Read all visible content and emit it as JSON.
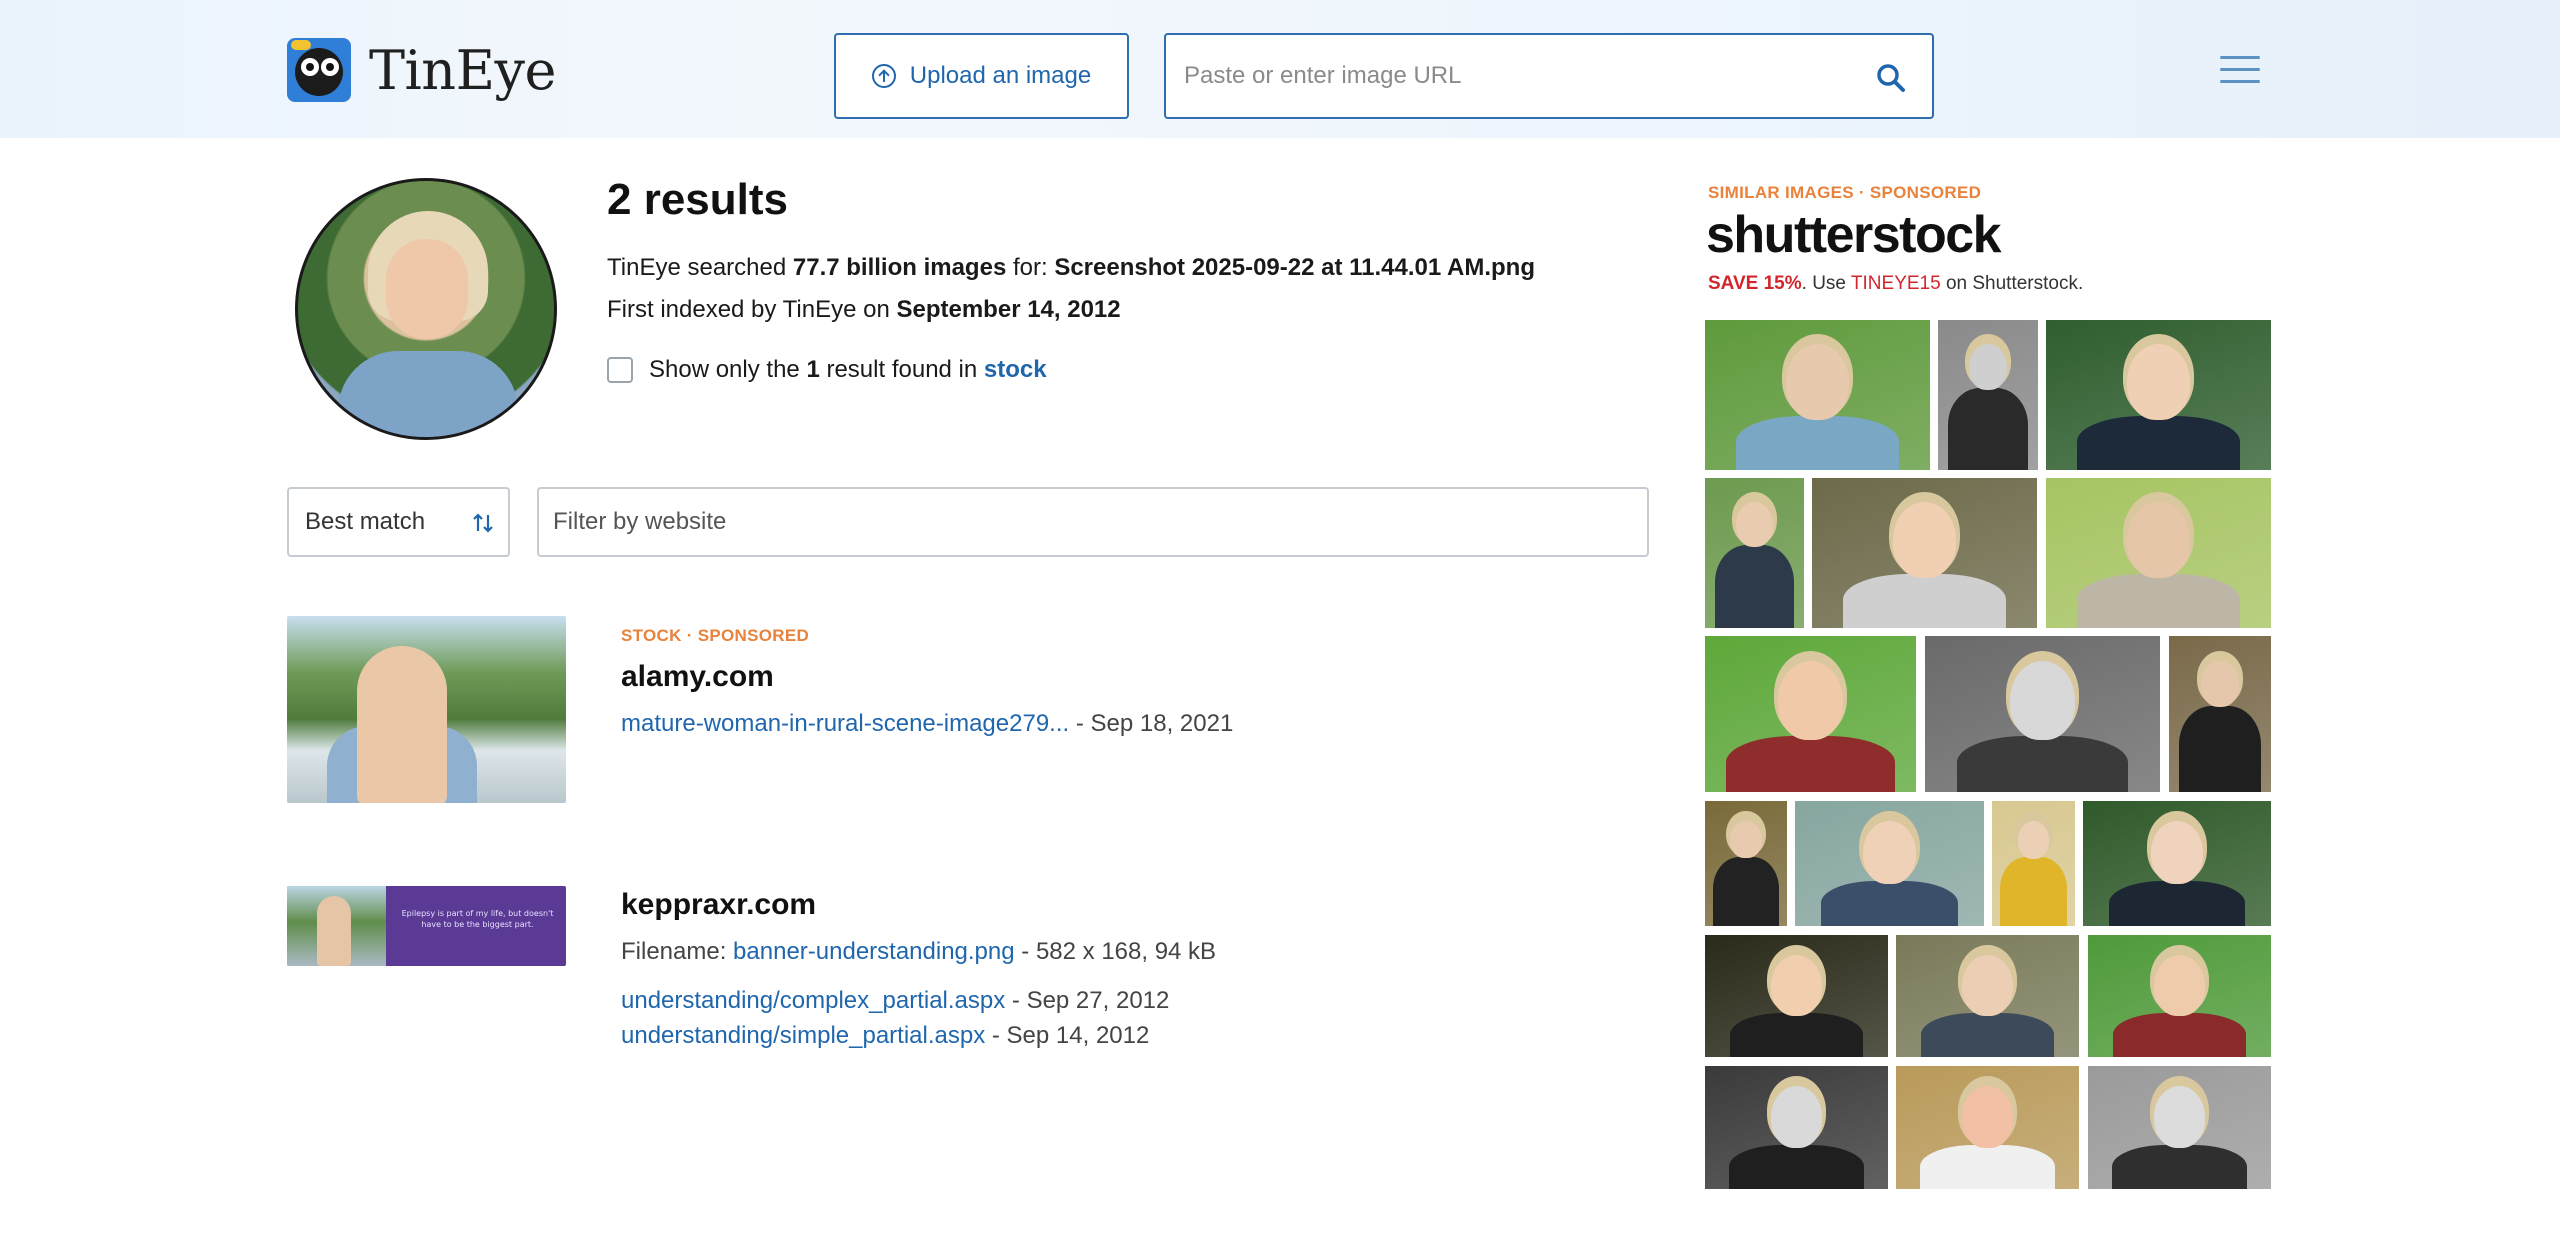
{
  "header": {
    "logo_text": "TinEye",
    "upload_label": "Upload an image",
    "url_placeholder": "Paste or enter image URL"
  },
  "summary": {
    "results_title": "2 results",
    "searched_prefix": "TinEye searched ",
    "searched_count": "77.7 billion images",
    "searched_for": " for: ",
    "filename": "Screenshot 2025-09-22 at 11.44.01 AM.png",
    "indexed_prefix": "First indexed by TinEye on ",
    "indexed_date": "September 14, 2012",
    "stock_prefix": "Show only the ",
    "stock_count": "1",
    "stock_middle": " result found in ",
    "stock_link": "stock"
  },
  "filters": {
    "sort_label": "Best match",
    "filter_placeholder": "Filter by website"
  },
  "results": [
    {
      "tags": "STOCK · SPONSORED",
      "domain": "alamy.com",
      "link": "mature-woman-in-rural-scene-image279...",
      "date": " - Sep 18, 2021"
    },
    {
      "domain": "keppraxr.com",
      "filename_label": "Filename: ",
      "filename": "banner-understanding.png",
      "file_meta": " - 582 x 168, 94 kB",
      "thumb_text": "Epilepsy is part of my life, but doesn't have to be the biggest part.",
      "links": [
        {
          "href_text": "understanding/complex_partial.aspx",
          "date": " - Sep 27, 2012"
        },
        {
          "href_text": "understanding/simple_partial.aspx",
          "date": " - Sep 14, 2012"
        }
      ]
    }
  ],
  "sidebar": {
    "tag": "SIMILAR IMAGES · SPONSORED",
    "brand": "shutterstock",
    "save_prefix": "SAVE 15%",
    "save_mid": ". Use ",
    "save_code": "TINEYE15",
    "save_suffix": " on Shutterstock.",
    "colors": {
      "accent": "#e8823c",
      "promo": "#d2262c",
      "link": "#1f66ad"
    }
  }
}
